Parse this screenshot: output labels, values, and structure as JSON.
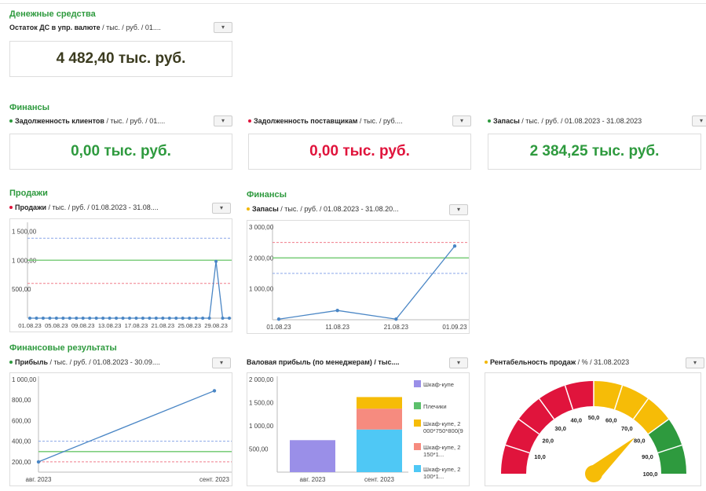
{
  "colors": {
    "section": "#2e9a3e",
    "green": "#2e9a3e",
    "red": "#e0143c",
    "dark": "#3b3b1f",
    "line": "#4a86c5",
    "ref_green": "#7fcf7f",
    "ref_red": "#f07c8a",
    "ref_blue": "#8aa6e8"
  },
  "cash": {
    "section_title": "Денежные средства",
    "widget_title_bold": "Остаток ДС в упр. валюте",
    "widget_title_rest": " / тыс. / руб. / 01....",
    "menu": "▾",
    "value": "4 482,40 тыс. руб."
  },
  "finance": {
    "section_title": "Финансы",
    "cards": [
      {
        "bold": "Задолженность клиентов",
        "rest": " / тыс. / руб. / 01....",
        "dot_color": "#2e9a3e",
        "value": "0,00 тыс. руб.",
        "value_color": "#2e9a3e",
        "menu": "▾"
      },
      {
        "bold": "Задолженность поставщикам",
        "rest": " / тыс. / руб....",
        "dot_color": "#e0143c",
        "value": "0,00 тыс. руб.",
        "value_color": "#e0143c",
        "menu": "▾"
      },
      {
        "bold": "Запасы",
        "rest": " / тыс. / руб. / 01.08.2023 - 31.08.2023",
        "dot_color": "#2e9a3e",
        "value": "2 384,25 тыс. руб.",
        "value_color": "#2e9a3e",
        "menu": "▾"
      }
    ]
  },
  "sales": {
    "section_title": "Продажи",
    "widget_bold": "Продажи",
    "widget_rest": " / тыс. / руб. / 01.08.2023 - 31.08....",
    "dot_color": "#e0143c",
    "menu": "▾"
  },
  "finance2": {
    "section_title": "Финансы",
    "widget_bold": "Запасы",
    "widget_rest": " / тыс. / руб. / 01.08.2023 - 31.08.20...",
    "dot_color": "#f2b705",
    "menu": "▾"
  },
  "results": {
    "section_title": "Финансовые результаты",
    "profit_bold": "Прибыль",
    "profit_rest": " / тыс. / руб. / 01.08.2023 - 30.09....",
    "profit_dot": "#2e9a3e",
    "gross_title": "Валовая прибыль (по менеджерам) / тыс....",
    "rent_bold": "Рентабельность продаж",
    "rent_rest": " / % / 31.08.2023",
    "rent_dot": "#f2b705",
    "menu": "▾"
  },
  "chart_data": [
    {
      "type": "line",
      "name": "sales",
      "yticks": [
        "1 500,00",
        "1 000,00",
        "500,00"
      ],
      "ylim": [
        0,
        1600
      ],
      "xticklabels": [
        "01.08.23",
        "05.08.23",
        "09.08.23",
        "13.08.23",
        "17.08.23",
        "21.08.23",
        "25.08.23",
        "29.08.23"
      ],
      "values": [
        0,
        0,
        0,
        0,
        0,
        0,
        0,
        0,
        0,
        0,
        0,
        0,
        0,
        0,
        0,
        0,
        0,
        0,
        0,
        0,
        0,
        0,
        0,
        0,
        0,
        0,
        0,
        0,
        980,
        0,
        0
      ],
      "ref_lines": [
        {
          "value": 1380,
          "color": "#8aa6e8"
        },
        {
          "value": 1000,
          "color": "#7fcf7f"
        },
        {
          "value": 600,
          "color": "#f07c8a"
        }
      ]
    },
    {
      "type": "line",
      "name": "inventory",
      "yticks": [
        "3 000,00",
        "2 000,00",
        "1 000,00"
      ],
      "ylim": [
        0,
        3000
      ],
      "x": [
        "01.08.23",
        "11.08.23",
        "21.08.23",
        "01.09.23"
      ],
      "values": [
        20,
        300,
        20,
        2384
      ],
      "ref_lines": [
        {
          "value": 2500,
          "color": "#f07c8a"
        },
        {
          "value": 2000,
          "color": "#7fcf7f"
        },
        {
          "value": 1500,
          "color": "#8aa6e8"
        }
      ]
    },
    {
      "type": "line",
      "name": "profit",
      "yticks": [
        "1 000,00",
        "800,00",
        "600,00",
        "400,00",
        "200,00"
      ],
      "ylim": [
        100,
        1000
      ],
      "x": [
        "авг. 2023",
        "сент. 2023"
      ],
      "values": [
        200,
        890
      ],
      "ref_lines": [
        {
          "value": 400,
          "color": "#8aa6e8"
        },
        {
          "value": 300,
          "color": "#7fcf7f"
        },
        {
          "value": 200,
          "color": "#f07c8a"
        }
      ]
    },
    {
      "type": "bar",
      "name": "gross-profit",
      "yticks": [
        "2 000,00",
        "1 500,00",
        "1 000,00",
        "500,00"
      ],
      "ylim": [
        0,
        2000
      ],
      "categories": [
        "авг. 2023",
        "сент. 2023"
      ],
      "series": [
        {
          "name": "Шкаф-купе",
          "color": "#9a8fe8",
          "values": [
            690,
            0
          ]
        },
        {
          "name": "Шкаф-купе, 2 100*1...",
          "color": "#4fc8f5",
          "values": [
            0,
            920
          ]
        },
        {
          "name": "Шкаф-купе, 2 150*1...",
          "color": "#f68b7f",
          "values": [
            0,
            450
          ]
        },
        {
          "name": "Шкаф-купе, 2 000*750*800(9",
          "color": "#f6bc07",
          "values": [
            0,
            250
          ]
        },
        {
          "name": "Плечики",
          "color": "#5cc06b",
          "values": [
            0,
            0
          ]
        }
      ],
      "legend": [
        {
          "label": "Шкаф-купе",
          "color": "#9a8fe8"
        },
        {
          "label": "Плечики",
          "color": "#5cc06b"
        },
        {
          "label": "Шкаф-купе, 2 000*750*800(9",
          "color": "#f6bc07"
        },
        {
          "label": "Шкаф-купе, 2 150*1...",
          "color": "#f68b7f"
        },
        {
          "label": "Шкаф-купе, 2 100*1...",
          "color": "#4fc8f5"
        }
      ]
    },
    {
      "type": "gauge",
      "name": "profitability",
      "value": 77,
      "range": [
        0,
        100
      ],
      "ticks": [
        "10,0",
        "20,0",
        "30,0",
        "40,0",
        "50,0",
        "60,0",
        "70,0",
        "80,0",
        "90,0",
        "100,0"
      ],
      "bands": [
        {
          "from": 0,
          "to": 50,
          "color": "#e0143c"
        },
        {
          "from": 50,
          "to": 80,
          "color": "#f6bc07"
        },
        {
          "from": 80,
          "to": 100,
          "color": "#2e9a3e"
        }
      ]
    }
  ]
}
